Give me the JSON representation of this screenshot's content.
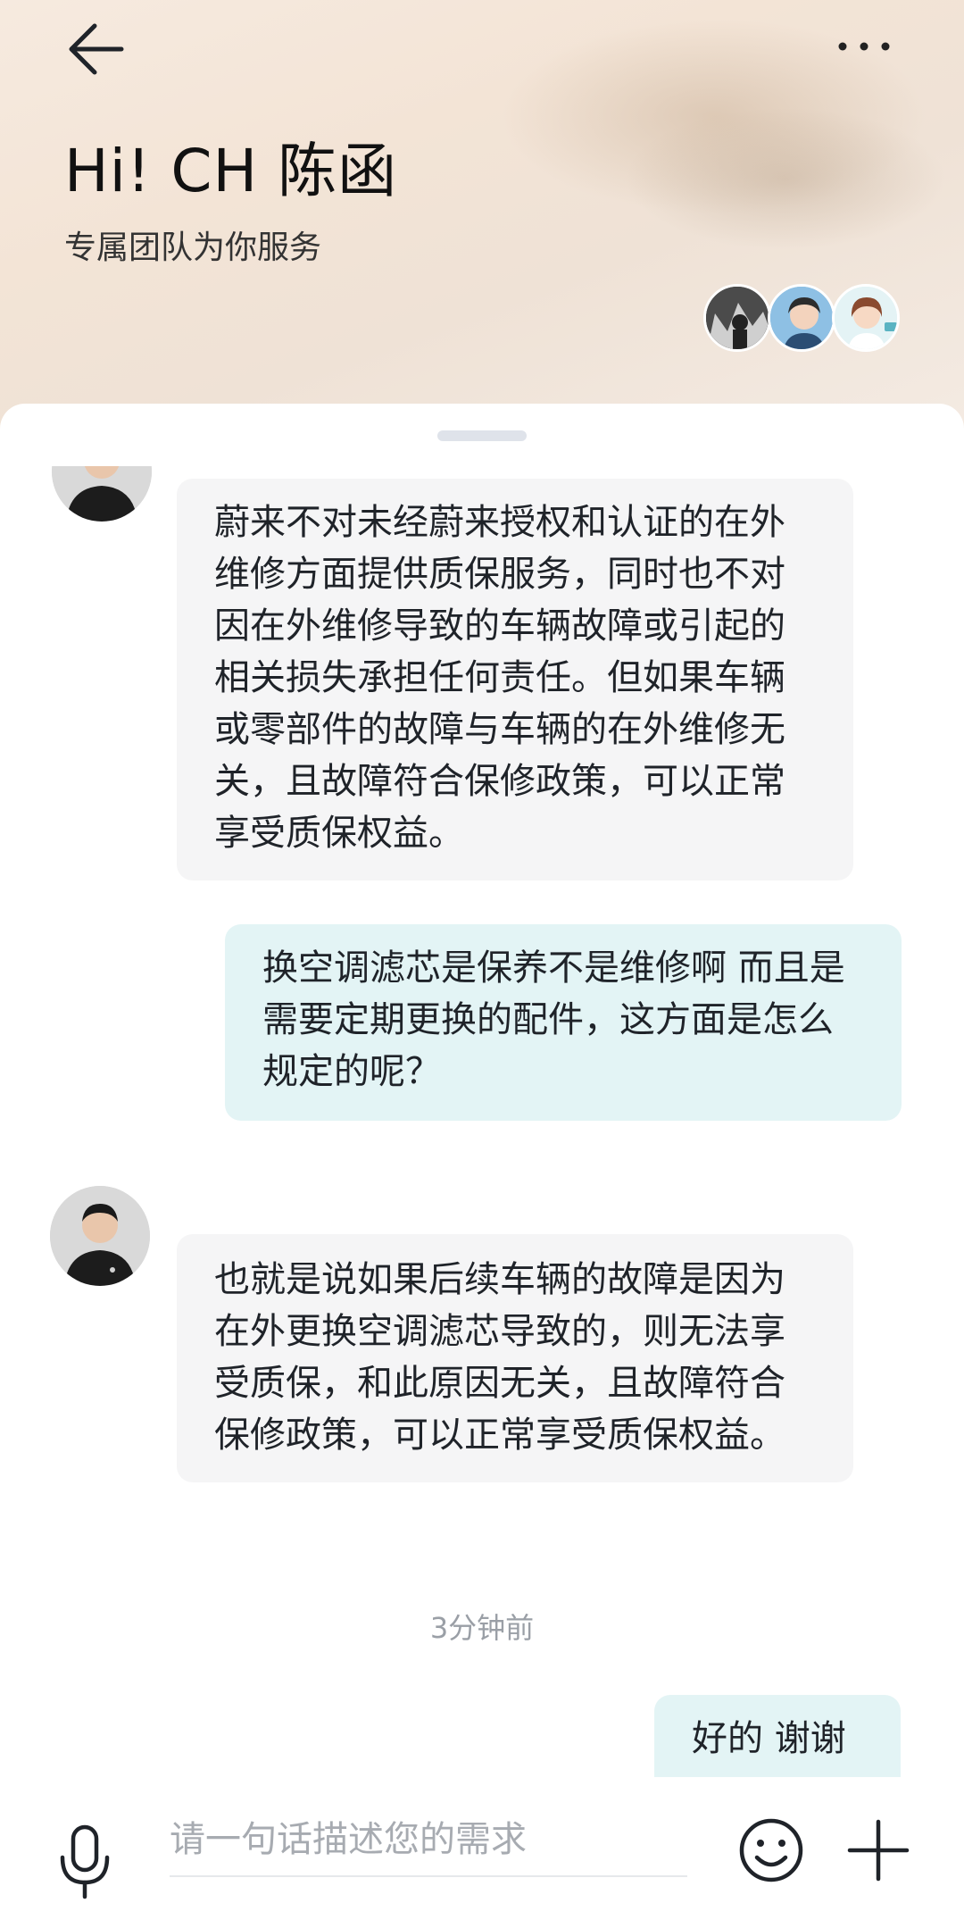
{
  "header": {
    "greeting": "Hi! CH 陈函",
    "subtitle": "专属团队为你服务",
    "back_icon": "arrow-left-icon",
    "more_icon": "more-dots-icon"
  },
  "messages": [
    {
      "from": "agent",
      "text": "蔚来不对未经蔚来授权和认证的在外维修方面提供质保服务，同时也不对因在外维修导致的车辆故障或引起的相关损失承担任何责任。但如果车辆或零部件的故障与车辆的在外维修无关，且故障符合保修政策，可以正常享受质保权益。"
    },
    {
      "from": "user",
      "text": "换空调滤芯是保养不是维修啊 而且是需要定期更换的配件，这方面是怎么规定的呢？"
    },
    {
      "from": "agent",
      "text": "也就是说如果后续车辆的故障是因为在外更换空调滤芯导致的，则无法享受质保，和此原因无关，且故障符合保修政策，可以正常享受质保权益。"
    },
    {
      "time": "3分钟前"
    },
    {
      "from": "user",
      "text": "好的 谢谢"
    }
  ],
  "input": {
    "placeholder": "请一句话描述您的需求",
    "value": ""
  },
  "colors": {
    "agent_bubble": "#f5f5f6",
    "user_bubble": "#e3f4f5",
    "header_bg": "#f3e4d6"
  }
}
